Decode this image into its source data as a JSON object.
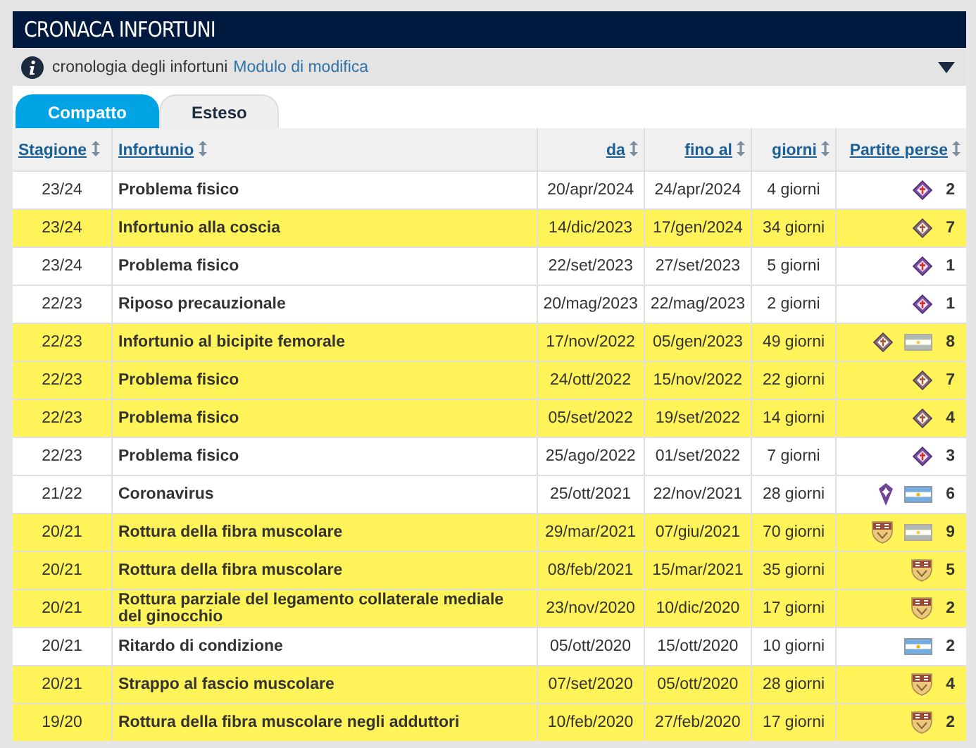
{
  "header": {
    "title": "CRONACA INFORTUNI"
  },
  "info_bar": {
    "text": "cronologia degli infortuni",
    "link": "Modulo di modifica",
    "expanded": false
  },
  "tabs": [
    {
      "label": "Compatto",
      "selected": true
    },
    {
      "label": "Esteso",
      "selected": false
    }
  ],
  "table": {
    "columns": [
      "Stagione",
      "Infortunio",
      "da",
      "fino al",
      "giorni",
      "Partite perse"
    ],
    "rows": [
      {
        "season": "23/24",
        "injury": "Problema fisico",
        "from": "20/apr/2024",
        "until": "24/apr/2024",
        "days": "4 giorni",
        "clubs": [
          {
            "kind": "diamond-crest"
          }
        ],
        "games": "2",
        "highlighted": false
      },
      {
        "season": "23/24",
        "injury": "Infortunio alla coscia",
        "from": "14/dic/2023",
        "until": "17/gen/2024",
        "days": "34 giorni",
        "clubs": [
          {
            "kind": "diamond-crest"
          }
        ],
        "games": "7",
        "highlighted": true
      },
      {
        "season": "23/24",
        "injury": "Problema fisico",
        "from": "22/set/2023",
        "until": "27/set/2023",
        "days": "5 giorni",
        "clubs": [
          {
            "kind": "diamond-crest"
          }
        ],
        "games": "1",
        "highlighted": false
      },
      {
        "season": "22/23",
        "injury": "Riposo precauzionale",
        "from": "20/mag/2023",
        "until": "22/mag/2023",
        "days": "2 giorni",
        "clubs": [
          {
            "kind": "diamond-crest"
          }
        ],
        "games": "1",
        "highlighted": false
      },
      {
        "season": "22/23",
        "injury": "Infortunio al bicipite femorale",
        "from": "17/nov/2022",
        "until": "05/gen/2023",
        "days": "49 giorni",
        "clubs": [
          {
            "kind": "diamond-crest"
          },
          {
            "kind": "flag"
          }
        ],
        "games": "8",
        "highlighted": true
      },
      {
        "season": "22/23",
        "injury": "Problema fisico",
        "from": "24/ott/2022",
        "until": "15/nov/2022",
        "days": "22 giorni",
        "clubs": [
          {
            "kind": "diamond-crest"
          }
        ],
        "games": "7",
        "highlighted": true
      },
      {
        "season": "22/23",
        "injury": "Problema fisico",
        "from": "05/set/2022",
        "until": "19/set/2022",
        "days": "14 giorni",
        "clubs": [
          {
            "kind": "diamond-crest"
          }
        ],
        "games": "4",
        "highlighted": true
      },
      {
        "season": "22/23",
        "injury": "Problema fisico",
        "from": "25/ago/2022",
        "until": "01/set/2022",
        "days": "7 giorni",
        "clubs": [
          {
            "kind": "diamond-crest"
          }
        ],
        "games": "3",
        "highlighted": false
      },
      {
        "season": "21/22",
        "injury": "Coronavirus",
        "from": "25/ott/2021",
        "until": "22/nov/2021",
        "days": "28 giorni",
        "clubs": [
          {
            "kind": "lily-crest"
          },
          {
            "kind": "flag"
          }
        ],
        "games": "6",
        "highlighted": false
      },
      {
        "season": "20/21",
        "injury": "Rottura della fibra muscolare",
        "from": "29/mar/2021",
        "until": "07/giu/2021",
        "days": "70 giorni",
        "clubs": [
          {
            "kind": "shield-crest"
          },
          {
            "kind": "flag"
          }
        ],
        "games": "9",
        "highlighted": true
      },
      {
        "season": "20/21",
        "injury": "Rottura della fibra muscolare",
        "from": "08/feb/2021",
        "until": "15/mar/2021",
        "days": "35 giorni",
        "clubs": [
          {
            "kind": "shield-crest"
          }
        ],
        "games": "5",
        "highlighted": true
      },
      {
        "season": "20/21",
        "injury": "Rottura parziale del legamento collaterale mediale del ginocchio",
        "from": "23/nov/2020",
        "until": "10/dic/2020",
        "days": "17 giorni",
        "clubs": [
          {
            "kind": "shield-crest"
          }
        ],
        "games": "2",
        "highlighted": true
      },
      {
        "season": "20/21",
        "injury": "Ritardo di condizione",
        "from": "05/ott/2020",
        "until": "15/ott/2020",
        "days": "10 giorni",
        "clubs": [
          {
            "kind": "flag"
          }
        ],
        "games": "2",
        "highlighted": false
      },
      {
        "season": "20/21",
        "injury": "Strappo al fascio muscolare",
        "from": "07/set/2020",
        "until": "05/ott/2020",
        "days": "28 giorni",
        "clubs": [
          {
            "kind": "shield-crest"
          }
        ],
        "games": "4",
        "highlighted": true
      },
      {
        "season": "19/20",
        "injury": "Rottura della fibra muscolare negli adduttori",
        "from": "10/feb/2020",
        "until": "27/feb/2020",
        "days": "17 giorni",
        "clubs": [
          {
            "kind": "shield-crest"
          }
        ],
        "games": "2",
        "highlighted": true
      }
    ]
  }
}
